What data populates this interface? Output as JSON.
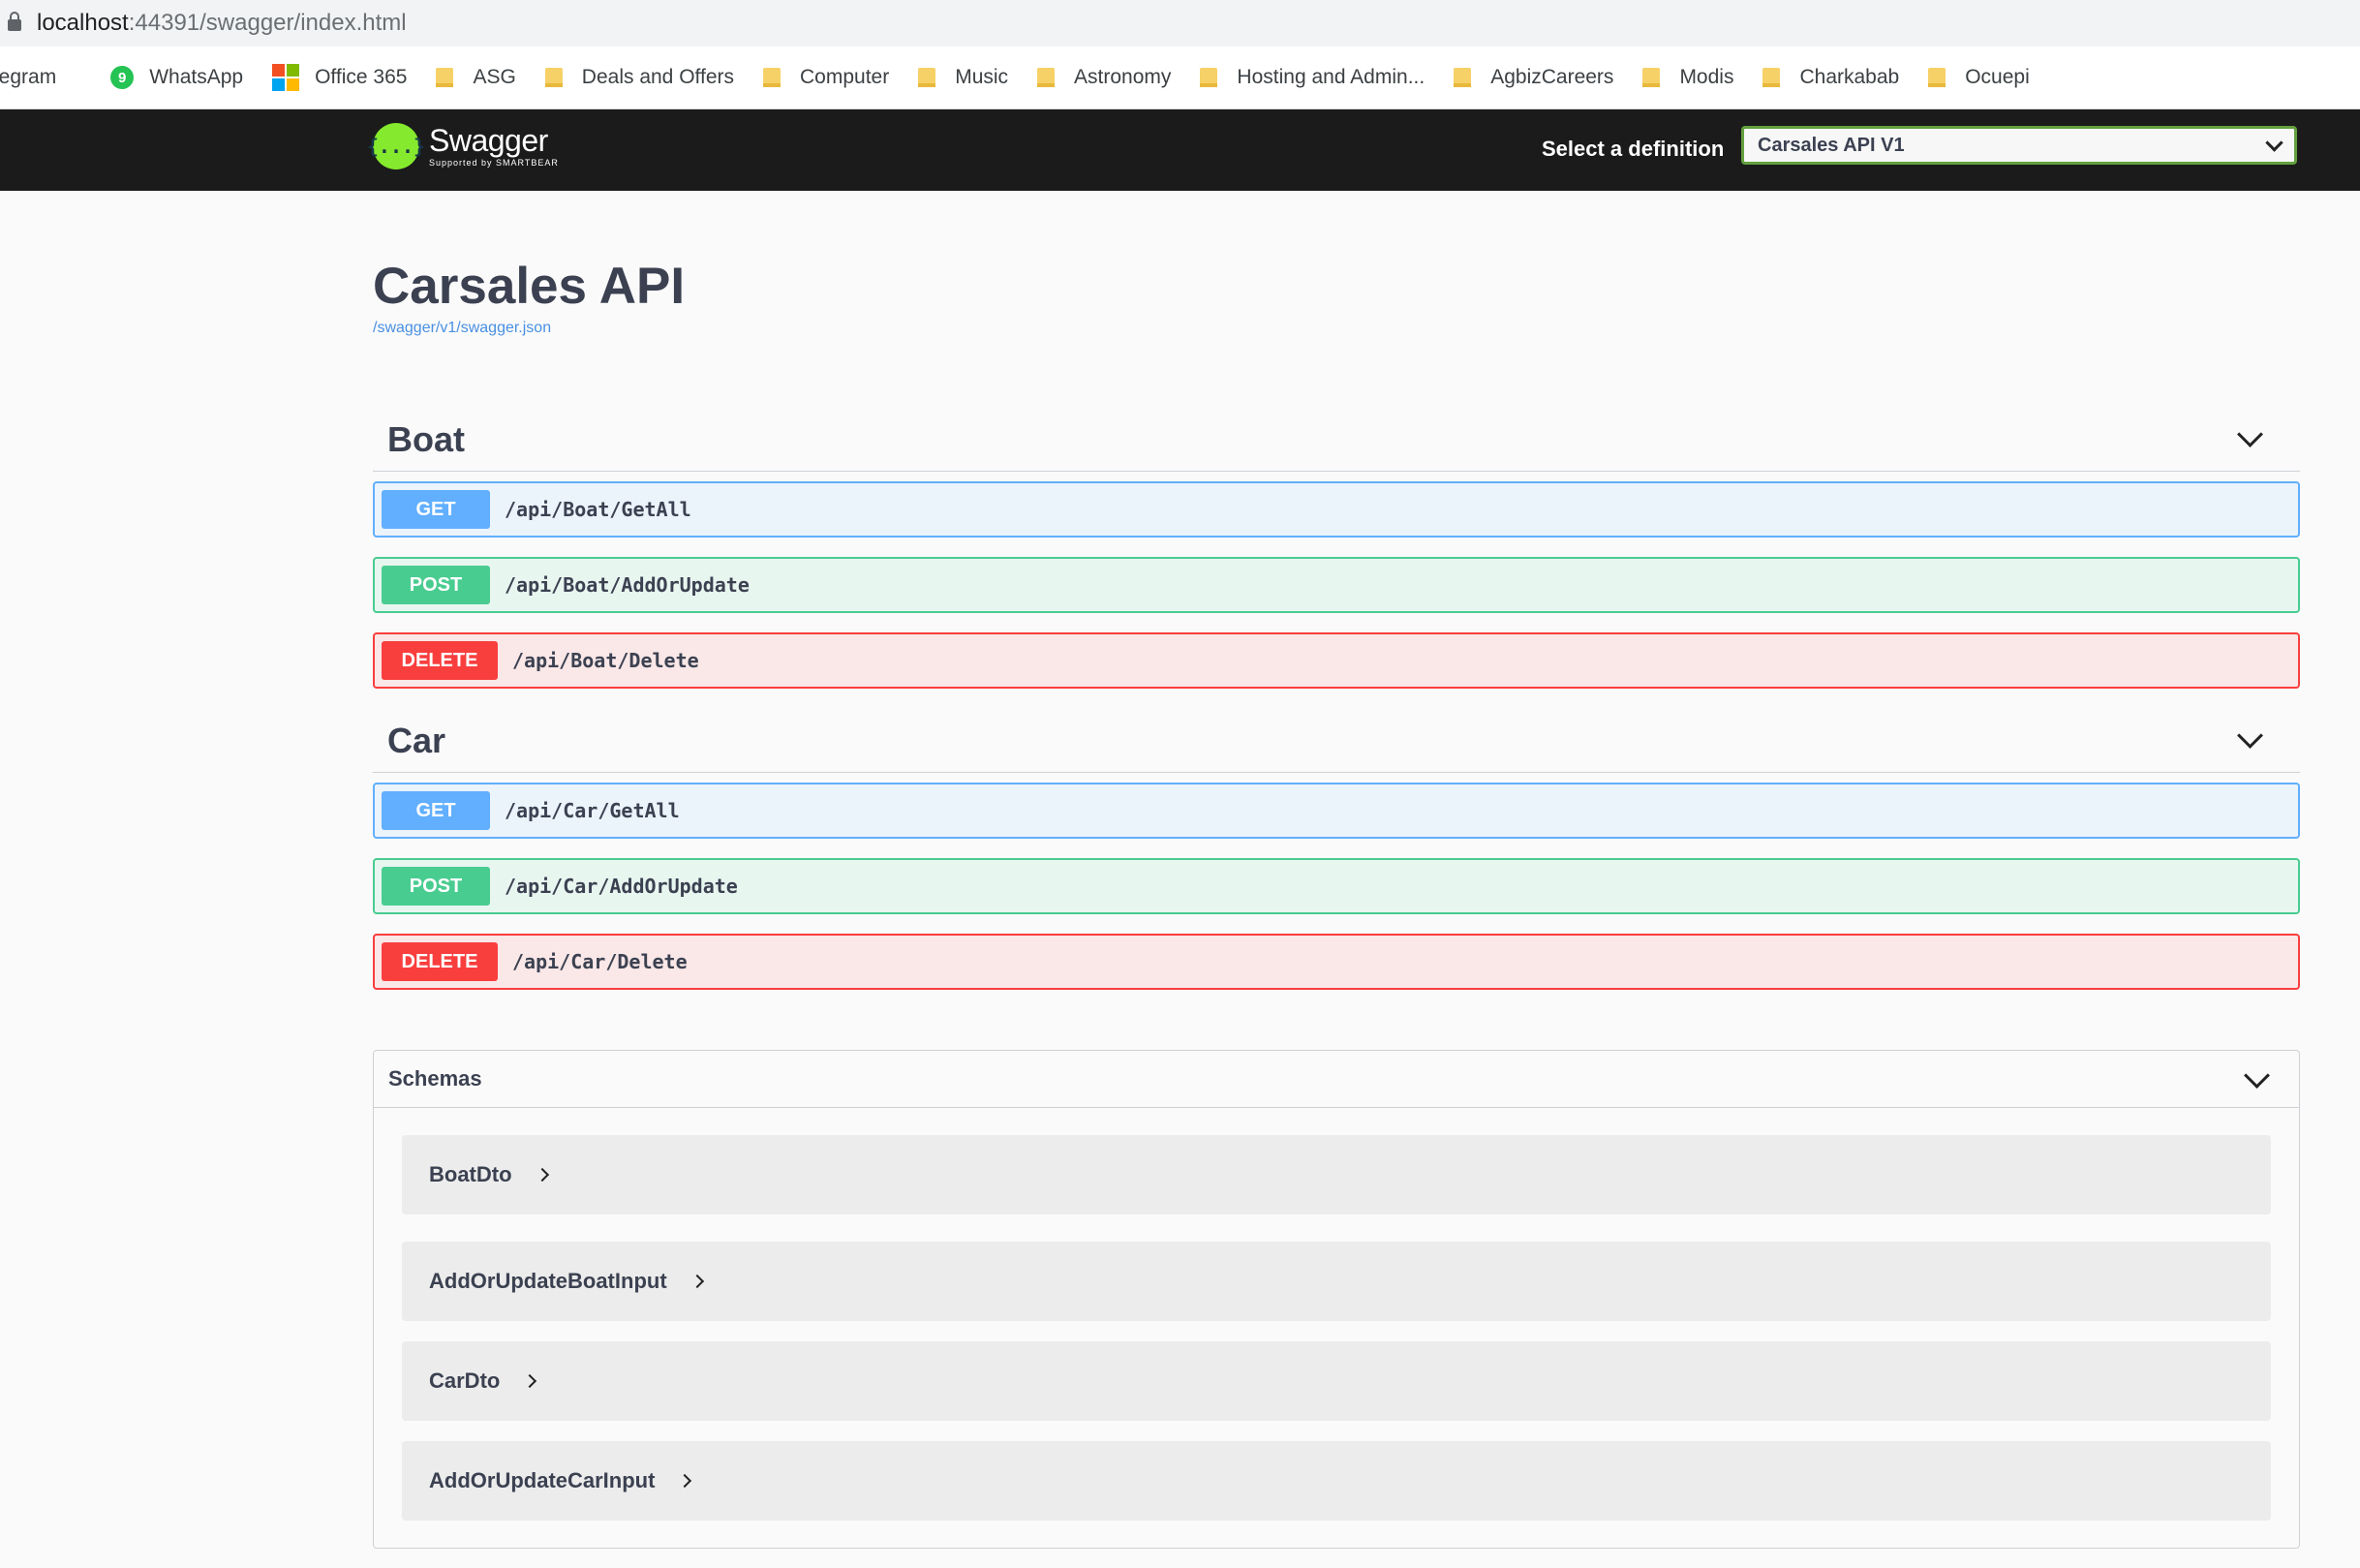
{
  "browser": {
    "url_host": "localhost",
    "url_path": ":44391/swagger/index.html",
    "bookmarks": [
      {
        "label": "legram",
        "icon": "telegram-icon"
      },
      {
        "label": "WhatsApp",
        "icon": "whatsapp-icon",
        "badge": "9"
      },
      {
        "label": "Office 365",
        "icon": "office-icon"
      },
      {
        "label": "ASG",
        "icon": "folder-icon"
      },
      {
        "label": "Deals and Offers",
        "icon": "folder-icon"
      },
      {
        "label": "Computer",
        "icon": "folder-icon"
      },
      {
        "label": "Music",
        "icon": "folder-icon"
      },
      {
        "label": "Astronomy",
        "icon": "folder-icon"
      },
      {
        "label": "Hosting and Admin...",
        "icon": "folder-icon"
      },
      {
        "label": "AgbizCareers",
        "icon": "folder-icon"
      },
      {
        "label": "Modis",
        "icon": "folder-icon"
      },
      {
        "label": "Charkabab",
        "icon": "folder-icon"
      },
      {
        "label": "Ocuepi",
        "icon": "folder-icon"
      }
    ]
  },
  "topbar": {
    "logo_name": "Swagger",
    "logo_sub": "Supported by SMARTBEAR",
    "logo_glyph": "{...}",
    "definition_label": "Select a definition",
    "definition_value": "Carsales API V1"
  },
  "info": {
    "title": "Carsales API",
    "spec_url": "/swagger/v1/swagger.json"
  },
  "tags": [
    {
      "name": "Boat",
      "operations": [
        {
          "method": "GET",
          "path": "/api/Boat/GetAll"
        },
        {
          "method": "POST",
          "path": "/api/Boat/AddOrUpdate"
        },
        {
          "method": "DELETE",
          "path": "/api/Boat/Delete"
        }
      ]
    },
    {
      "name": "Car",
      "operations": [
        {
          "method": "GET",
          "path": "/api/Car/GetAll"
        },
        {
          "method": "POST",
          "path": "/api/Car/AddOrUpdate"
        },
        {
          "method": "DELETE",
          "path": "/api/Car/Delete"
        }
      ]
    }
  ],
  "schemas": {
    "title": "Schemas",
    "items": [
      "BoatDto",
      "AddOrUpdateBoatInput",
      "CarDto",
      "AddOrUpdateCarInput"
    ]
  },
  "colors": {
    "get": "#61affe",
    "post": "#49cc90",
    "delete": "#f93e3e",
    "topbar": "#1b1b1b",
    "logo": "#85ea2d"
  }
}
